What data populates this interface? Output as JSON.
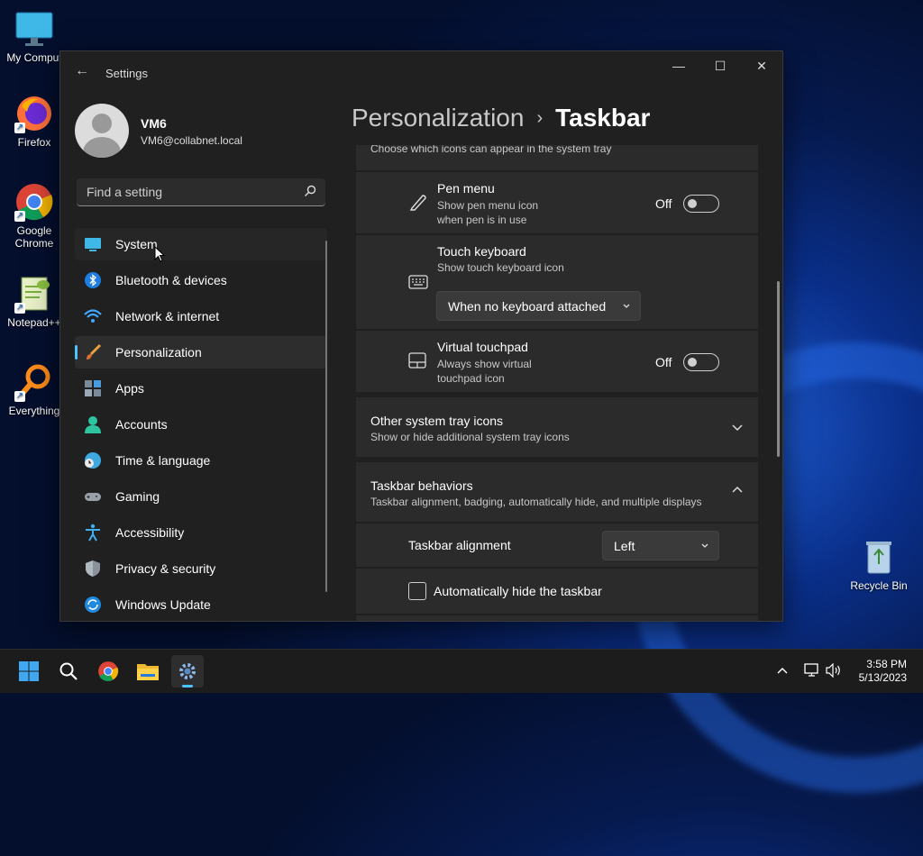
{
  "desktop": {
    "icons": [
      {
        "label": "My Comput"
      },
      {
        "label": "Firefox"
      },
      {
        "label": "Google Chrome"
      },
      {
        "label": "Notepad++"
      },
      {
        "label": "Everything"
      },
      {
        "label": "Recycle Bin"
      }
    ]
  },
  "window": {
    "title": "Settings",
    "controls": {
      "minimize": "—",
      "maximize": "☐",
      "close": "✕"
    },
    "back_icon": "←"
  },
  "user": {
    "name": "VM6",
    "email": "VM6@collabnet.local"
  },
  "search": {
    "placeholder": "Find a setting"
  },
  "nav": {
    "selected": "Personalization",
    "hovered": "System",
    "items": [
      {
        "label": "System",
        "icon": "monitor-icon"
      },
      {
        "label": "Bluetooth & devices",
        "icon": "bluetooth-icon"
      },
      {
        "label": "Network & internet",
        "icon": "wifi-icon"
      },
      {
        "label": "Personalization",
        "icon": "brush-icon"
      },
      {
        "label": "Apps",
        "icon": "apps-icon"
      },
      {
        "label": "Accounts",
        "icon": "person-icon"
      },
      {
        "label": "Time & language",
        "icon": "globe-clock-icon"
      },
      {
        "label": "Gaming",
        "icon": "gamepad-icon"
      },
      {
        "label": "Accessibility",
        "icon": "accessibility-icon"
      },
      {
        "label": "Privacy & security",
        "icon": "shield-icon"
      },
      {
        "label": "Windows Update",
        "icon": "update-icon"
      }
    ]
  },
  "breadcrumb": {
    "parent": "Personalization",
    "separator": "›",
    "current": "Taskbar"
  },
  "tray_section": {
    "truncated_sub": "Choose which icons can appear in the system tray",
    "pen_menu": {
      "title": "Pen menu",
      "sub": "Show pen menu icon when pen is in use",
      "state": "Off"
    },
    "touch_keyboard": {
      "title": "Touch keyboard",
      "sub": "Show touch keyboard icon",
      "dropdown": "When no keyboard attached"
    },
    "virtual_touchpad": {
      "title": "Virtual touchpad",
      "sub": "Always show virtual touchpad icon",
      "state": "Off"
    }
  },
  "other_tray": {
    "title": "Other system tray icons",
    "sub": "Show or hide additional system tray icons"
  },
  "behaviors": {
    "title": "Taskbar behaviors",
    "sub": "Taskbar alignment, badging, automatically hide, and multiple displays",
    "alignment_label": "Taskbar alignment",
    "alignment_value": "Left",
    "autohide_label": "Automatically hide the taskbar",
    "autohide_checked": false
  },
  "taskbar": {
    "time": "3:58 PM",
    "date": "5/13/2023"
  },
  "colors": {
    "accent": "#4cc2ff",
    "window_bg": "#202020",
    "card_bg": "#2b2b2b"
  }
}
